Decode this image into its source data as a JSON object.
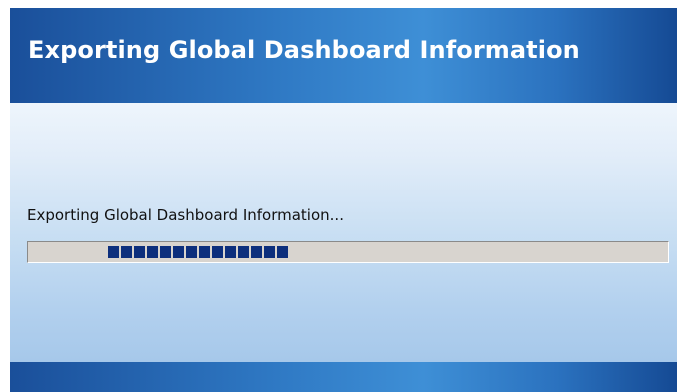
{
  "dialog": {
    "title": "Exporting Global Dashboard Information",
    "status_text": "Exporting Global Dashboard Information...",
    "progress": {
      "style": "marquee",
      "segments_visible": 14,
      "block_color": "#0d2f7d",
      "track_color": "#d8d4cf"
    },
    "colors": {
      "banner_dark": "#1a4f9a",
      "banner_light": "#3e8fd6",
      "body_top": "#eef5fc",
      "body_bottom": "#a6c8ea"
    }
  }
}
